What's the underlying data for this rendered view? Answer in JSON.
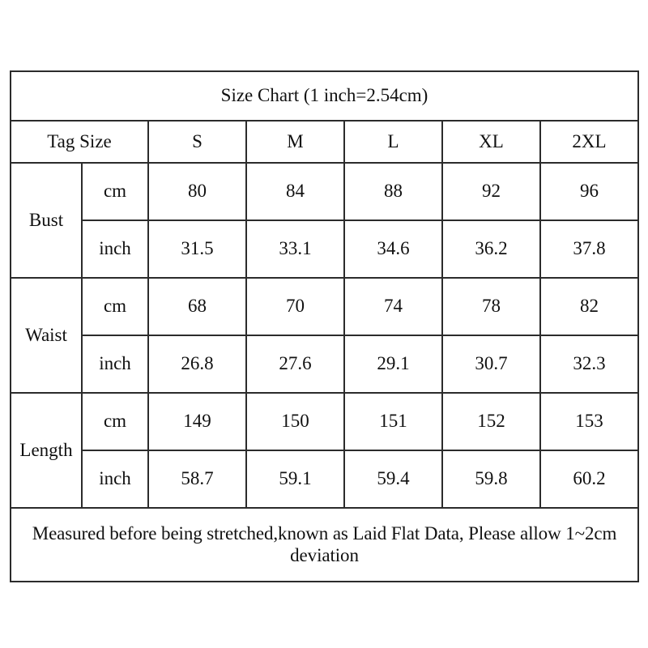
{
  "chart": {
    "title": "Size Chart (1 inch=2.54cm)",
    "tag_size_label": "Tag Size",
    "footnote": "Measured before being stretched,known as Laid Flat Data, Please allow 1~2cm deviation",
    "sizes": [
      "S",
      "M",
      "L",
      "XL",
      "2XL"
    ],
    "units": {
      "cm": "cm",
      "inch": "inch"
    },
    "measurements": [
      {
        "name": "Bust",
        "cm": [
          "80",
          "84",
          "88",
          "92",
          "96"
        ],
        "inch": [
          "31.5",
          "33.1",
          "34.6",
          "36.2",
          "37.8"
        ]
      },
      {
        "name": "Waist",
        "cm": [
          "68",
          "70",
          "74",
          "78",
          "82"
        ],
        "inch": [
          "26.8",
          "27.6",
          "29.1",
          "30.7",
          "32.3"
        ]
      },
      {
        "name": "Length",
        "cm": [
          "149",
          "150",
          "151",
          "152",
          "153"
        ],
        "inch": [
          "58.7",
          "59.1",
          "59.4",
          "59.8",
          "60.2"
        ]
      }
    ],
    "colors": {
      "border": "#2b2b2b",
      "text": "#111111",
      "background": "#ffffff"
    }
  },
  "chart_data": {
    "type": "table",
    "title": "Size Chart (1 inch=2.54cm)",
    "columns": [
      "Tag Size",
      "S",
      "M",
      "L",
      "XL",
      "2XL"
    ],
    "rows": [
      {
        "measurement": "Bust",
        "unit": "cm",
        "values": [
          "80",
          "84",
          "88",
          "92",
          "96"
        ]
      },
      {
        "measurement": "Bust",
        "unit": "inch",
        "values": [
          "31.5",
          "33.1",
          "34.6",
          "36.2",
          "37.8"
        ]
      },
      {
        "measurement": "Waist",
        "unit": "cm",
        "values": [
          "68",
          "70",
          "74",
          "78",
          "82"
        ]
      },
      {
        "measurement": "Waist",
        "unit": "inch",
        "values": [
          "26.8",
          "27.6",
          "29.1",
          "30.7",
          "32.3"
        ]
      },
      {
        "measurement": "Length",
        "unit": "cm",
        "values": [
          "149",
          "150",
          "151",
          "152",
          "153"
        ]
      },
      {
        "measurement": "Length",
        "unit": "inch",
        "values": [
          "58.7",
          "59.1",
          "59.4",
          "59.8",
          "60.2"
        ]
      }
    ],
    "note": "Measured before being stretched,known as Laid Flat Data, Please allow 1~2cm deviation"
  }
}
